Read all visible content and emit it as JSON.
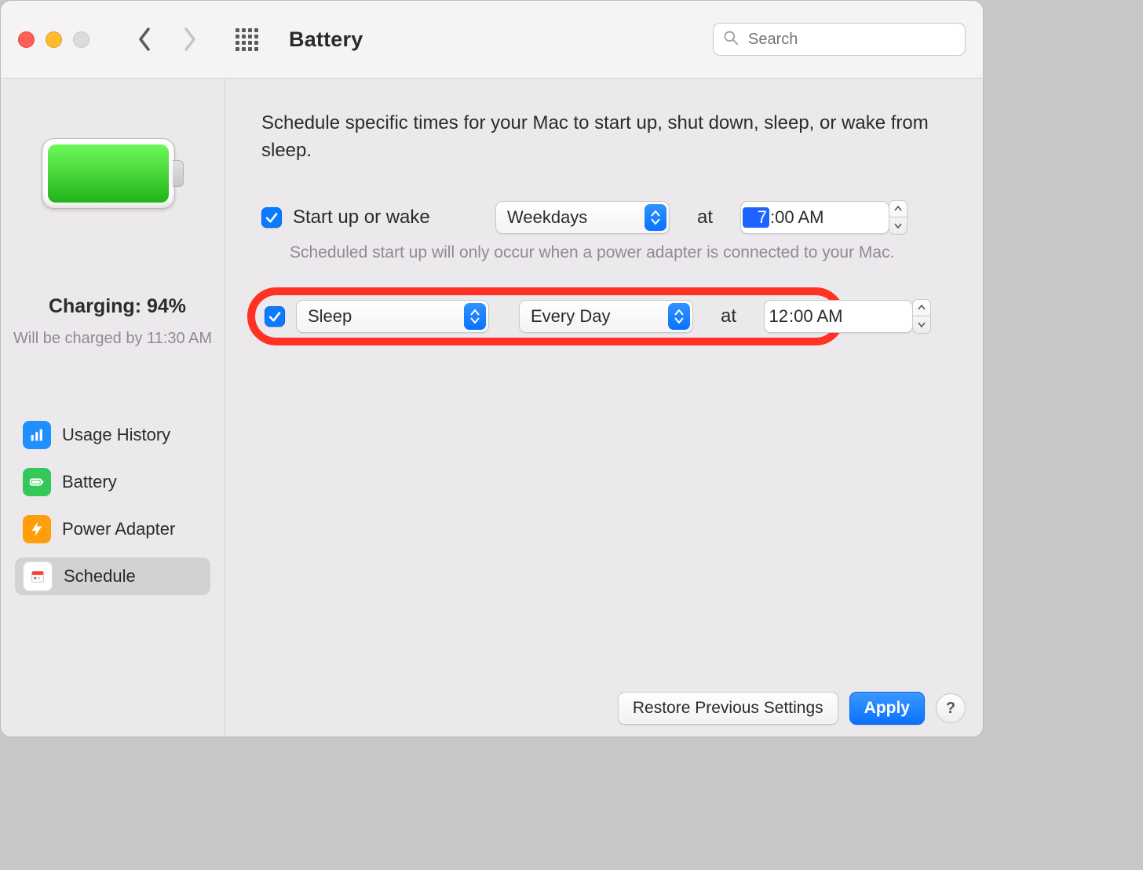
{
  "toolbar": {
    "title": "Battery",
    "search_placeholder": "Search"
  },
  "sidebar": {
    "charging_label": "Charging: 94%",
    "charging_note": "Will be charged by 11:30 AM",
    "items": [
      {
        "label": "Usage History"
      },
      {
        "label": "Battery"
      },
      {
        "label": "Power Adapter"
      },
      {
        "label": "Schedule"
      }
    ],
    "selected_index": 3
  },
  "main": {
    "description": "Schedule specific times for your Mac to start up, shut down, sleep, or wake from sleep.",
    "row1": {
      "checked": true,
      "label": "Start up or wake",
      "day_value": "Weekdays",
      "at": "at",
      "time_hour": "7",
      "time_rest": ":00 AM",
      "hour_selected": true
    },
    "note1": "Scheduled start up will only occur when a power adapter is connected to your Mac.",
    "row2": {
      "checked": true,
      "action_value": "Sleep",
      "day_value": "Every Day",
      "at": "at",
      "time_hour": "12",
      "time_rest": ":00 AM",
      "hour_selected": false
    }
  },
  "footer": {
    "restore": "Restore Previous Settings",
    "apply": "Apply",
    "help": "?"
  }
}
